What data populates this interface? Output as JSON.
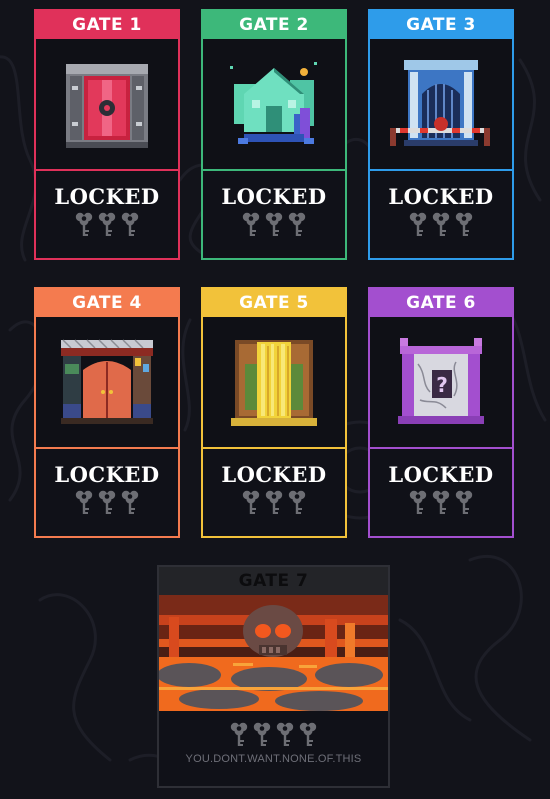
{
  "gates": [
    {
      "title": "GATE 1",
      "status": "LOCKED",
      "color": "#e0315a",
      "keys": 3
    },
    {
      "title": "GATE 2",
      "status": "LOCKED",
      "color": "#3db87a",
      "keys": 3
    },
    {
      "title": "GATE 3",
      "status": "LOCKED",
      "color": "#2e9cea",
      "keys": 3
    },
    {
      "title": "GATE 4",
      "status": "LOCKED",
      "color": "#f47b4f",
      "keys": 3
    },
    {
      "title": "GATE 5",
      "status": "LOCKED",
      "color": "#f2c23a",
      "keys": 3
    },
    {
      "title": "GATE 6",
      "status": "LOCKED",
      "color": "#a34fcf",
      "keys": 3
    }
  ],
  "gate7": {
    "title": "GATE 7",
    "tagline": "YOU.DONT.WANT.NONE.OF.THIS",
    "keys": 4,
    "header_color": "#232428",
    "border_color": "#2e2f36"
  },
  "key_icon": "skeleton-key-icon",
  "background_color": "#12131a"
}
